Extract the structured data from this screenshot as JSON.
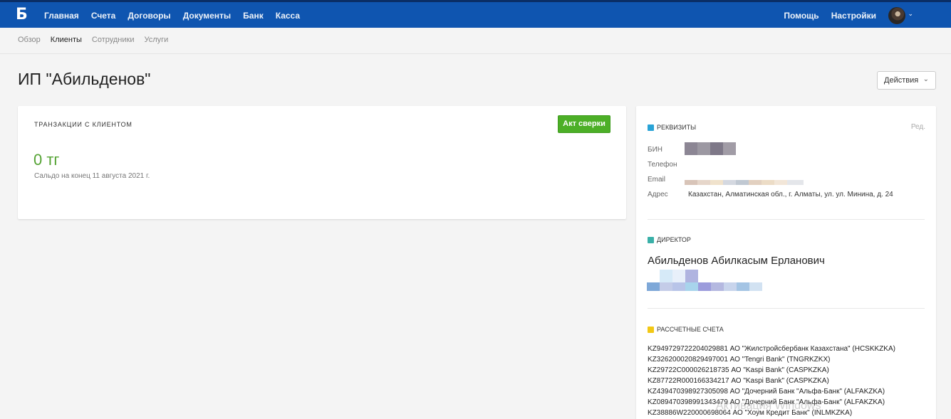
{
  "topbar": {
    "logo": "Б",
    "nav": [
      "Главная",
      "Счета",
      "Договоры",
      "Документы",
      "Банк",
      "Касса"
    ],
    "right": [
      "Помощь",
      "Настройки"
    ]
  },
  "subnav": [
    "Обзор",
    "Клиенты",
    "Сотрудники",
    "Услуги"
  ],
  "page": {
    "title": "ИП \"Абильденов\"",
    "actions_label": "Действия"
  },
  "transactions": {
    "title": "ТРАНЗАКЦИИ С КЛИЕНТОМ",
    "act_button": "Акт сверки",
    "amount": "0 тг",
    "saldo": "Сальдо на конец 11 августа 2021 г."
  },
  "requisites": {
    "title": "РЕКВИЗИТЫ",
    "edit": "Ред.",
    "bin_label": "БИН",
    "phone_label": "Телефон",
    "email_label": "Email",
    "address_label": "Адрес",
    "address_value": "Казахстан, Алматинская обл., г. Алматы, ул. ул. Минина, д. 24"
  },
  "director": {
    "title": "ДИРЕКТОР",
    "name": "Абильденов Абилкасым Ерланович"
  },
  "accounts": {
    "title": "РАССЧЕТНЫЕ СЧЕТА",
    "items": [
      "KZ949729722204029881 АО \"Жилстройсбербанк Казахстана\" (HCSKKZKA)",
      "KZ326200020829497001 АО \"Tengri Bank\" (TNGRKZKX)",
      "KZ29722C000026218735 АО \"Kaspi Bank\" (CASPKZKA)",
      "KZ87722R000166334217 АО \"Kaspi Bank\" (CASPKZKA)",
      "KZ439470398927305098 АО \"Дочерний Банк \"Альфа-Банк\" (ALFAKZKA)",
      "KZ089470398991343479 АО \"Дочерний Банк \"Альфа-Банк\" (ALFAKZKA)",
      "KZ38886W220000698064 АО \"Хоум Кредит Банк\" (INLMKZKA)"
    ]
  },
  "watermark": "Активация Windows",
  "colors": {
    "topbar": "#0f55b0",
    "accent_green": "#4caf27",
    "amount_green": "#55a334"
  }
}
